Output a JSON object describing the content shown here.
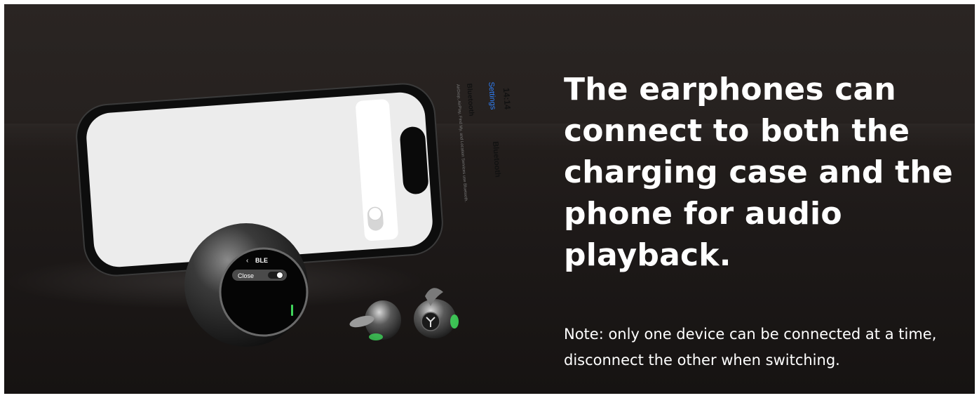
{
  "headline": "The earphones can connect to both the charging case and the phone for audio playback.",
  "note": "Note: only one device can be connected at a time, disconnect the other when switching.",
  "phone_screen": {
    "time": "14:14",
    "back_label": "Settings",
    "title": "Bluetooth",
    "row_label": "Bluetooth",
    "description": "AirDrop, AirPlay, Find My, and Location Services use Bluetooth."
  },
  "case_screen": {
    "title": "BLE",
    "toggle_label": "Close"
  },
  "colors": {
    "background": "#211c1a",
    "text": "#ffffff",
    "ios_link": "#2f7ff6",
    "earbud_accent": "#3fd35a"
  }
}
